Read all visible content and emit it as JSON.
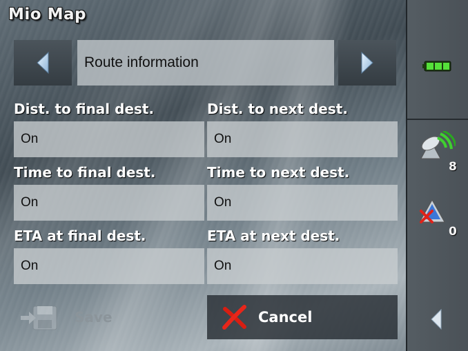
{
  "app": {
    "title": "Mio Map"
  },
  "nav": {
    "title": "Route information"
  },
  "fields": [
    {
      "label": "Dist. to final dest.",
      "value": "On"
    },
    {
      "label": "Dist. to next dest.",
      "value": "On"
    },
    {
      "label": "Time to final dest.",
      "value": "On"
    },
    {
      "label": "Time to next dest.",
      "value": "On"
    },
    {
      "label": "ETA at final dest.",
      "value": "On"
    },
    {
      "label": "ETA at next dest.",
      "value": "On"
    }
  ],
  "actions": {
    "save_label": "Save",
    "cancel_label": "Cancel"
  },
  "status": {
    "battery_color": "#55e03a",
    "gps_satellites": "8",
    "traffic_alerts": "0"
  },
  "icons": [
    "left-arrow-icon",
    "right-arrow-icon",
    "floppy-disk-icon",
    "red-x-icon",
    "battery-icon",
    "satellite-icon",
    "traffic-warning-icon",
    "back-arrow-icon"
  ]
}
